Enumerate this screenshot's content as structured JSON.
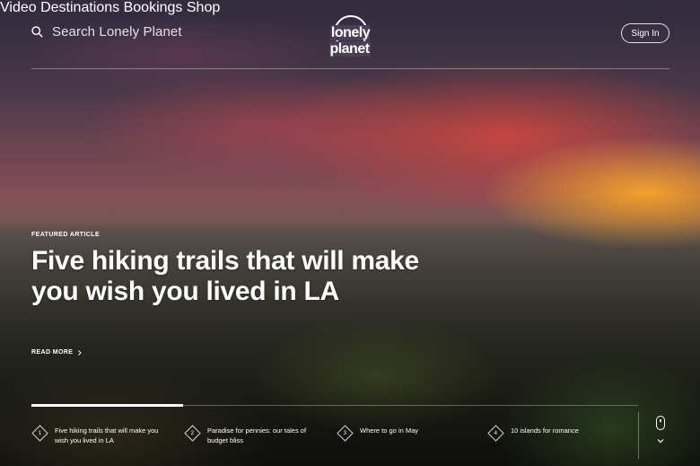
{
  "header": {
    "search_placeholder": "Search Lonely Planet",
    "logo_text": "lonely planet",
    "nav": [
      "Video",
      "Destinations",
      "Bookings",
      "Shop"
    ],
    "sign_in": "Sign In"
  },
  "featured": {
    "label": "FEATURED ARTICLE",
    "headline": "Five hiking trails that will make you wish you lived in LA",
    "read_more": "READ MORE"
  },
  "carousel": {
    "items": [
      {
        "number": "1",
        "title": "Five hiking trails that will make you wish you lived in LA"
      },
      {
        "number": "2",
        "title": "Paradise for pennies: our tales of budget bliss"
      },
      {
        "number": "3",
        "title": "Where to go in May"
      },
      {
        "number": "4",
        "title": "10 islands for romance"
      }
    ],
    "progress": 0.25
  },
  "icons": {
    "search": "search-icon",
    "scroll": "mouse-scroll-icon",
    "chevron": "chevron-down-icon",
    "read_more_arrow": "chevron-right-icon"
  },
  "colors": {
    "text": "#ffffff",
    "sunset_orange": "#ff8c1a",
    "sunset_red": "#e0464a"
  }
}
